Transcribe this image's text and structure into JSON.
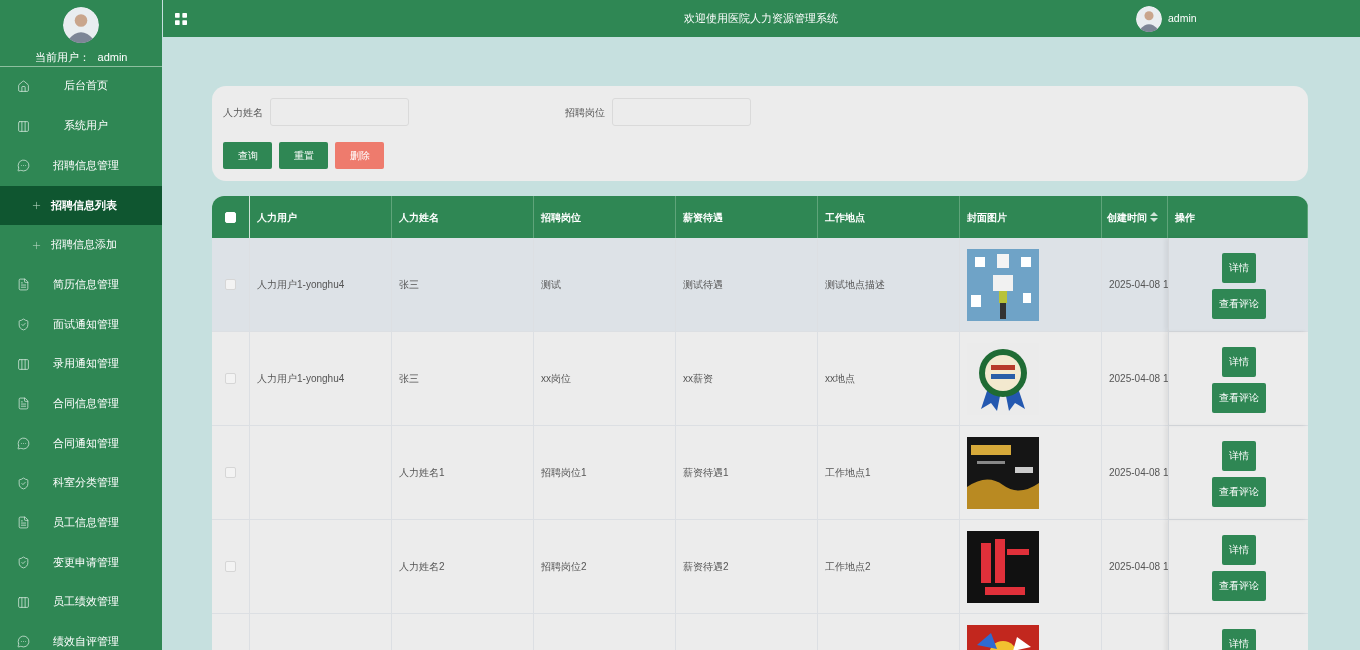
{
  "sidebar": {
    "user_label": "当前用户：",
    "user_name": "admin",
    "items": [
      {
        "label": "后台首页",
        "kind": "menu",
        "selected": false
      },
      {
        "label": "系统用户",
        "kind": "menu",
        "selected": false
      },
      {
        "label": "招聘信息管理",
        "kind": "menu",
        "selected": false
      },
      {
        "label": "招聘信息列表",
        "kind": "submenu",
        "selected": true
      },
      {
        "label": "招聘信息添加",
        "kind": "submenu",
        "selected": false
      },
      {
        "label": "简历信息管理",
        "kind": "menu",
        "selected": false
      },
      {
        "label": "面试通知管理",
        "kind": "menu",
        "selected": false
      },
      {
        "label": "录用通知管理",
        "kind": "menu",
        "selected": false
      },
      {
        "label": "合同信息管理",
        "kind": "menu",
        "selected": false
      },
      {
        "label": "合同通知管理",
        "kind": "menu",
        "selected": false
      },
      {
        "label": "科室分类管理",
        "kind": "menu",
        "selected": false
      },
      {
        "label": "员工信息管理",
        "kind": "menu",
        "selected": false
      },
      {
        "label": "变更申请管理",
        "kind": "menu",
        "selected": false
      },
      {
        "label": "员工绩效管理",
        "kind": "menu",
        "selected": false
      },
      {
        "label": "绩效自评管理",
        "kind": "menu",
        "selected": false
      }
    ]
  },
  "header": {
    "title": "欢迎使用医院人力资源管理系统",
    "user_name": "admin"
  },
  "search": {
    "fields": [
      {
        "label": "人力姓名"
      },
      {
        "label": "招聘岗位"
      }
    ],
    "buttons": [
      {
        "label": "查询",
        "kind": "primary"
      },
      {
        "label": "重置",
        "kind": "primary"
      },
      {
        "label": "删除",
        "kind": "danger"
      }
    ]
  },
  "table": {
    "select_all_checked": false,
    "columns": [
      {
        "label": "人力用户",
        "sortable": false
      },
      {
        "label": "人力姓名",
        "sortable": false
      },
      {
        "label": "招聘岗位",
        "sortable": false
      },
      {
        "label": "薪资待遇",
        "sortable": false
      },
      {
        "label": "工作地点",
        "sortable": false
      },
      {
        "label": "封面图片",
        "sortable": false
      },
      {
        "label": "创建时间",
        "sortable": true
      },
      {
        "label": "操作",
        "sortable": false
      }
    ],
    "rows": [
      {
        "checked": false,
        "hovered": true,
        "cells": [
          "人力用户1-yonghu4",
          "张三",
          "测试",
          "测试待遇",
          "测试地点描述"
        ],
        "picture": {
          "kind": "picture"
        },
        "created": "2025-04-08 1",
        "actions": [
          "详情",
          "查看评论"
        ]
      },
      {
        "checked": false,
        "hovered": false,
        "cells": [
          "人力用户1-yonghu4",
          "张三",
          "xx岗位",
          "xx薪资",
          "xx地点"
        ],
        "picture": {
          "kind": "picture"
        },
        "created": "2025-04-08 1",
        "actions": [
          "详情",
          "查看评论"
        ]
      },
      {
        "checked": false,
        "hovered": false,
        "cells": [
          "",
          "人力姓名1",
          "招聘岗位1",
          "薪资待遇1",
          "工作地点1"
        ],
        "picture": {
          "kind": "picture"
        },
        "created": "2025-04-08 1",
        "actions": [
          "详情",
          "查看评论"
        ]
      },
      {
        "checked": false,
        "hovered": false,
        "cells": [
          "",
          "人力姓名2",
          "招聘岗位2",
          "薪资待遇2",
          "工作地点2"
        ],
        "picture": {
          "kind": "picture"
        },
        "created": "2025-04-08 1",
        "actions": [
          "详情",
          "查看评论"
        ]
      },
      {
        "hovered": false,
        "cells": [],
        "picture": {
          "kind": "picture"
        },
        "actions": [
          "详情"
        ]
      }
    ]
  }
}
